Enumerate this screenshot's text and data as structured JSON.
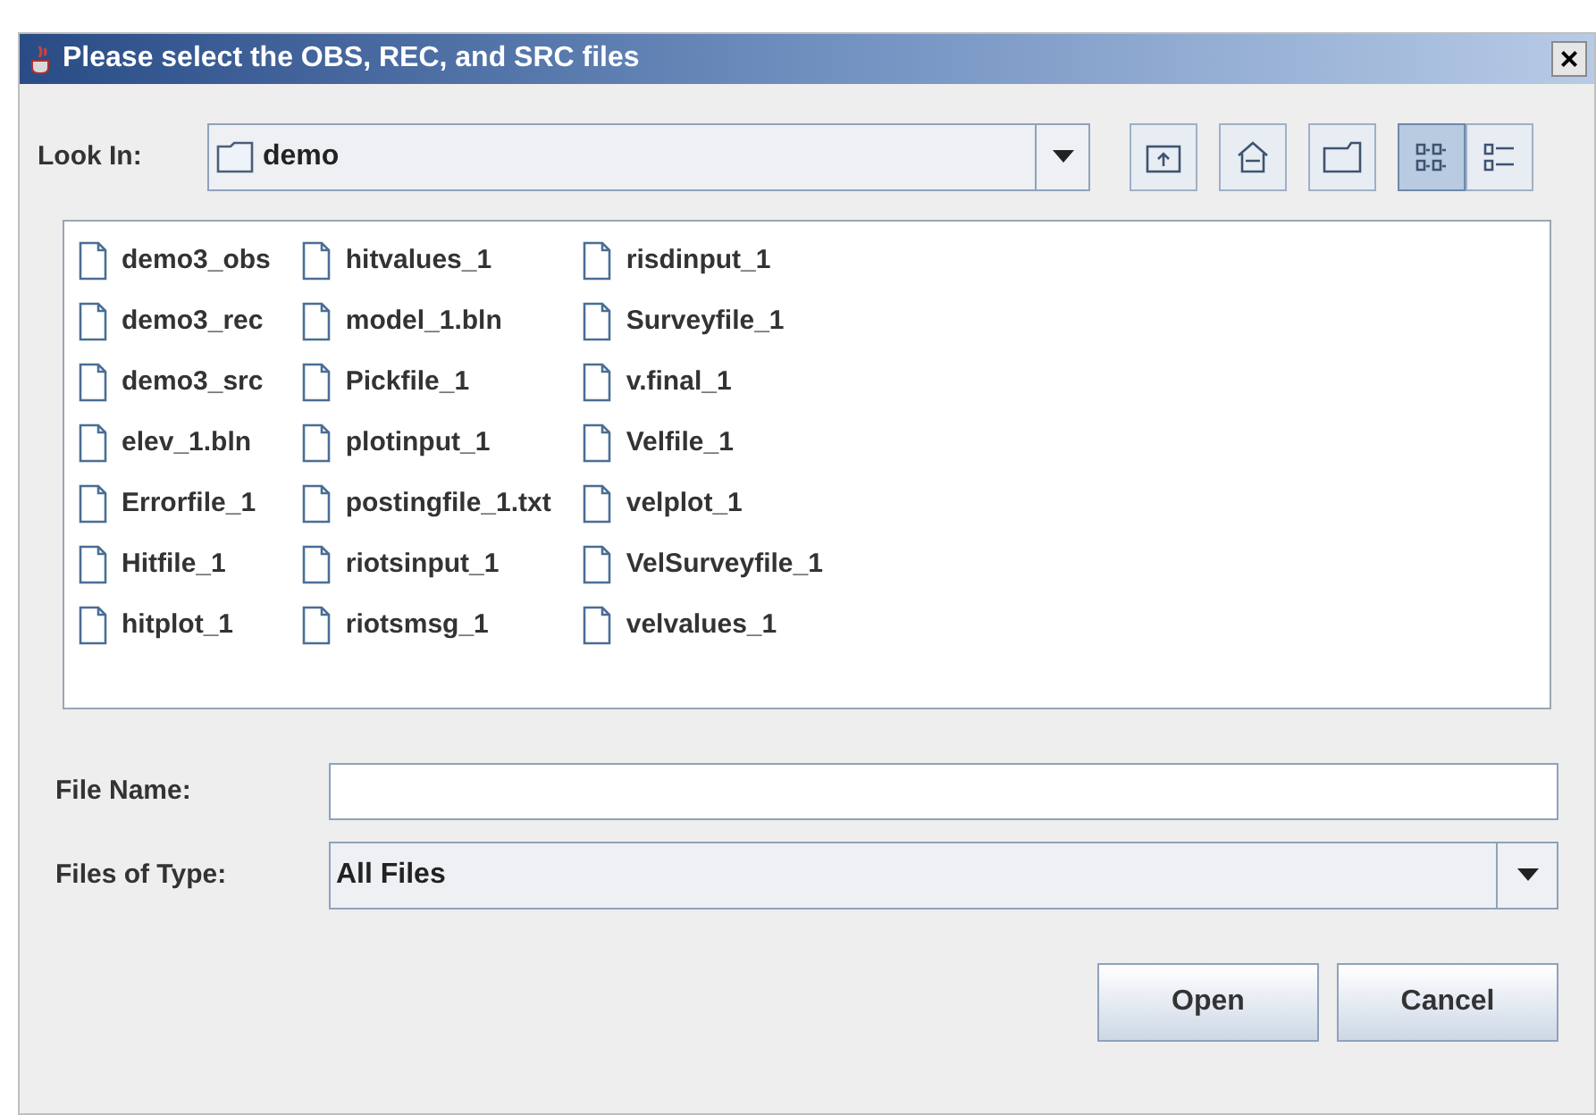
{
  "window": {
    "title": "Please select the OBS, REC, and SRC files",
    "close": "×"
  },
  "look_in": {
    "label": "Look In:",
    "value": "demo"
  },
  "toolbar": [
    {
      "kind": "up",
      "selected": false
    },
    {
      "kind": "home",
      "selected": false
    },
    {
      "kind": "new_folder",
      "selected": false
    },
    {
      "kind": "list",
      "selected": true
    },
    {
      "kind": "details",
      "selected": false
    }
  ],
  "files": [
    [
      "demo3_obs",
      "demo3_rec",
      "demo3_src",
      "elev_1.bln",
      "Errorfile_1",
      "Hitfile_1",
      "hitplot_1"
    ],
    [
      "hitvalues_1",
      "model_1.bln",
      "Pickfile_1",
      "plotinput_1",
      "postingfile_1.txt",
      "riotsinput_1",
      "riotsmsg_1"
    ],
    [
      "risdinput_1",
      "Surveyfile_1",
      "v.final_1",
      "Velfile_1",
      "velplot_1",
      "VelSurveyfile_1",
      "velvalues_1"
    ]
  ],
  "file_name": {
    "label": "File Name:"
  },
  "file_type": {
    "label": "Files of Type:",
    "value": "All Files"
  },
  "buttons": [
    "Open",
    "Cancel"
  ]
}
